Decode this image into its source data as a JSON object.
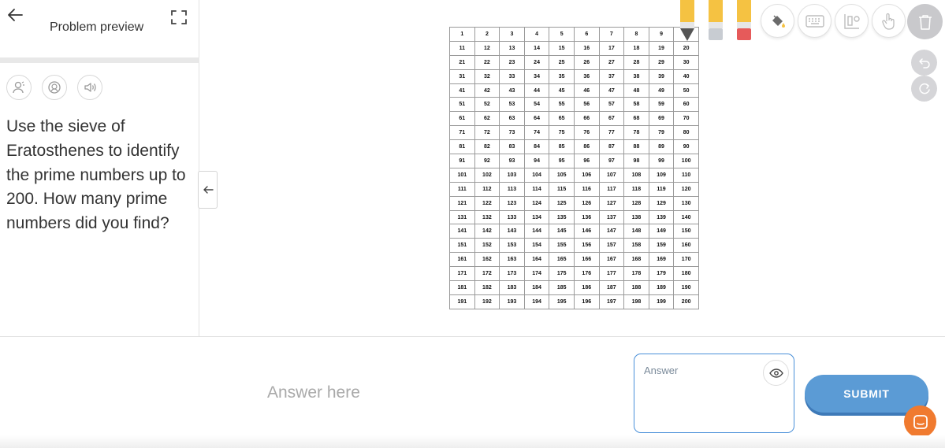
{
  "header": {
    "title": "Problem preview",
    "back_icon": "arrow-left-icon",
    "expand_icon": "fullscreen-icon"
  },
  "tools": {
    "audio_buttons": [
      "person-voice-icon",
      "speaker-face-icon",
      "speaker-icon"
    ]
  },
  "problem": {
    "text": "Use the sieve of Eratosthenes to identify the prime numbers up to 200. How many prime numbers did you find?"
  },
  "grid": {
    "rows": [
      [
        "1",
        "2",
        "3",
        "4",
        "5",
        "6",
        "7",
        "8",
        "9",
        ""
      ],
      [
        "11",
        "12",
        "13",
        "14",
        "15",
        "16",
        "17",
        "18",
        "19",
        "20"
      ],
      [
        "21",
        "22",
        "23",
        "24",
        "25",
        "26",
        "27",
        "28",
        "29",
        "30"
      ],
      [
        "31",
        "32",
        "33",
        "34",
        "35",
        "36",
        "37",
        "38",
        "39",
        "40"
      ],
      [
        "41",
        "42",
        "43",
        "44",
        "45",
        "46",
        "47",
        "48",
        "49",
        "50"
      ],
      [
        "51",
        "52",
        "53",
        "54",
        "55",
        "56",
        "57",
        "58",
        "59",
        "60"
      ],
      [
        "61",
        "62",
        "63",
        "64",
        "65",
        "66",
        "67",
        "68",
        "69",
        "70"
      ],
      [
        "71",
        "72",
        "73",
        "74",
        "75",
        "76",
        "77",
        "78",
        "79",
        "80"
      ],
      [
        "81",
        "82",
        "83",
        "84",
        "85",
        "86",
        "87",
        "88",
        "89",
        "90"
      ],
      [
        "91",
        "92",
        "93",
        "94",
        "95",
        "96",
        "97",
        "98",
        "99",
        "100"
      ],
      [
        "101",
        "102",
        "103",
        "104",
        "105",
        "106",
        "107",
        "108",
        "109",
        "110"
      ],
      [
        "111",
        "112",
        "113",
        "114",
        "115",
        "116",
        "117",
        "118",
        "119",
        "120"
      ],
      [
        "121",
        "122",
        "123",
        "124",
        "125",
        "126",
        "127",
        "128",
        "129",
        "130"
      ],
      [
        "131",
        "132",
        "133",
        "134",
        "135",
        "136",
        "137",
        "138",
        "139",
        "140"
      ],
      [
        "141",
        "142",
        "143",
        "144",
        "145",
        "146",
        "147",
        "148",
        "149",
        "150"
      ],
      [
        "151",
        "152",
        "153",
        "154",
        "155",
        "156",
        "157",
        "158",
        "159",
        "160"
      ],
      [
        "161",
        "162",
        "163",
        "164",
        "165",
        "166",
        "167",
        "168",
        "169",
        "170"
      ],
      [
        "171",
        "172",
        "173",
        "174",
        "175",
        "176",
        "177",
        "178",
        "179",
        "180"
      ],
      [
        "181",
        "182",
        "183",
        "184",
        "185",
        "186",
        "187",
        "188",
        "189",
        "190"
      ],
      [
        "191",
        "192",
        "193",
        "194",
        "195",
        "196",
        "197",
        "198",
        "199",
        "200"
      ]
    ]
  },
  "toolbar": {
    "pencils": [
      {
        "name": "pencil-tool",
        "color": "#f5c242",
        "tip": "#555555"
      },
      {
        "name": "highlighter-tool",
        "color": "#f5c242",
        "tip": "#c8ccd2"
      },
      {
        "name": "eraser-tool",
        "color": "#f5c242",
        "tip": "#e65a5a"
      }
    ],
    "buttons": [
      "paint-bucket-icon",
      "keyboard-icon",
      "shapes-icon",
      "hand-pointer-icon"
    ],
    "trash_icon": "trash-icon",
    "undo_icon": "undo-icon",
    "redo_icon": "redo-icon"
  },
  "answer": {
    "placeholder": "Answer here",
    "box_label": "Answer",
    "submit_label": "SUBMIT"
  },
  "colors": {
    "accent": "#5b9bd5",
    "chat": "#f07a2f"
  }
}
